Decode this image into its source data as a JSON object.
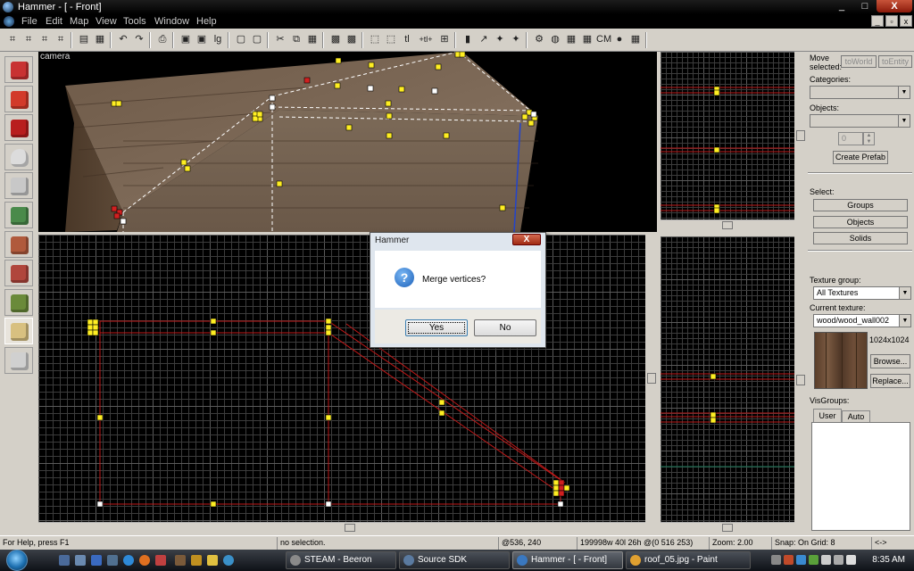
{
  "window": {
    "title": "Hammer - [ - Front]",
    "min": "_",
    "max": "□",
    "close": "X"
  },
  "menu": [
    "File",
    "Edit",
    "Map",
    "View",
    "Tools",
    "Window",
    "Help"
  ],
  "mdi": {
    "min": "_",
    "restore": "▫",
    "close": "x"
  },
  "toolbar": {
    "groups": [
      [
        "⌗",
        "⌗",
        "⌗",
        "⌗"
      ],
      [
        "▤",
        "▦"
      ],
      [
        "↶",
        "↷"
      ],
      [
        "⎙"
      ],
      [
        "▣",
        "▣",
        "lg"
      ],
      [
        "▢",
        "▢"
      ],
      [
        "✂",
        "⧉",
        "▦"
      ],
      [
        "▩",
        "▩"
      ],
      [
        "⬚",
        "⬚",
        "tl",
        "+tl+",
        "⊞"
      ],
      [
        "▮",
        "↗",
        "✦",
        "✦"
      ],
      [
        "⚙",
        "◍",
        "▦",
        "▦",
        "CM",
        "●",
        "▦"
      ]
    ],
    "cm_label": "CM"
  },
  "palette": [
    {
      "name": "selection-tool",
      "color": "#c83232"
    },
    {
      "name": "magnify-tool",
      "color": "#d23a2a"
    },
    {
      "name": "camera-tool",
      "color": "#b81e1e"
    },
    {
      "name": "entity-tool",
      "color": "#dcdcdc"
    },
    {
      "name": "block-tool",
      "color": "#c8c8c8"
    },
    {
      "name": "texture-application-tool",
      "color": "#4a8a4a"
    },
    {
      "name": "apply-decals-tool",
      "color": "#b05a3c"
    },
    {
      "name": "apply-overlays-tool",
      "color": "#b0463c"
    },
    {
      "name": "clipping-tool",
      "color": "#6a8a3a"
    },
    {
      "name": "vertex-tool",
      "color": "#d8c080"
    },
    {
      "name": "path-tool",
      "color": "#d0d0d0"
    }
  ],
  "camera_view": {
    "label": "camera"
  },
  "right_panel": {
    "move_selected_label": "Move\nselected:",
    "to_world": "toWorld",
    "to_entity": "toEntity",
    "categories_label": "Categories:",
    "categories_value": "",
    "objects_label": "Objects:",
    "objects_value": "",
    "count_value": "0",
    "create_prefab": "Create Prefab",
    "select_label": "Select:",
    "select_groups": "Groups",
    "select_objects": "Objects",
    "select_solids": "Solids",
    "texture_group_label": "Texture group:",
    "texture_group_value": "All Textures",
    "current_texture_label": "Current texture:",
    "current_texture_value": "wood/wood_wall002",
    "texture_size": "1024x1024",
    "browse": "Browse...",
    "replace": "Replace...",
    "visgroups_label": "VisGroups:",
    "tab_user": "User",
    "tab_auto": "Auto"
  },
  "dialog": {
    "title": "Hammer",
    "close": "X",
    "icon": "?",
    "message": "Merge vertices?",
    "yes": "Yes",
    "no": "No"
  },
  "status": {
    "help": "For Help, press F1",
    "selection": "no selection.",
    "coords": "@536, 240",
    "size": "199998w 40l 26h @(0 516 253)",
    "zoom": "Zoom: 2.00",
    "snap": "Snap: On Grid: 8",
    "extra": "<->"
  },
  "taskbar": {
    "tasks": [
      {
        "label": "STEAM - Beeron",
        "icon_color": "#8a8a8a",
        "active": false
      },
      {
        "label": "Source SDK",
        "icon_color": "#5a7aa0",
        "active": false
      },
      {
        "label": "Hammer - [ - Front]",
        "icon_color": "#3a78c0",
        "active": true
      },
      {
        "label": "roof_05.jpg - Paint",
        "icon_color": "#e0a030",
        "active": false
      }
    ],
    "clock": "8:35 AM"
  },
  "colors": {
    "grid_line": "#3c3c3c",
    "grid_major": "#5a5a5a",
    "brush_red": "#c01818",
    "vertex_yellow": "#ffee22",
    "vertex_white": "#ffffff"
  }
}
